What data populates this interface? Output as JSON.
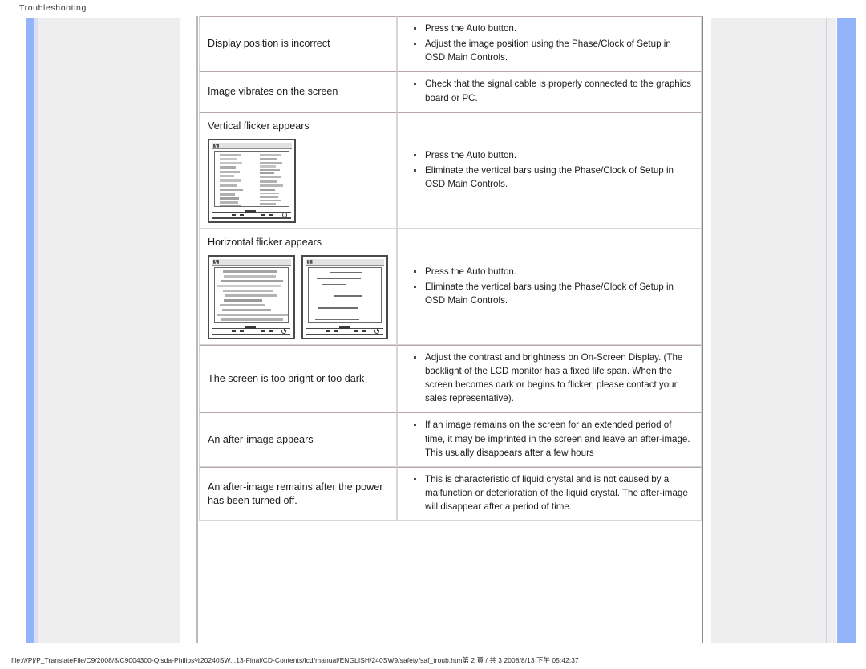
{
  "header": {
    "title": "Troubleshooting"
  },
  "footer": {
    "text": "file:///P|/P_TranslateFile/C9/2008/8/C9004300-Qisda-Philips%20240SW...13-Final/CD-Contents/lcd/manual/ENGLISH/240SW9/safety/saf_troub.htm第 2 頁 / 共 3 2008/8/13 下午 05:42:37"
  },
  "colors": {
    "accent_blue": "#93b3fa",
    "panel_gray": "#eeeeee",
    "table_border": "#d6d6d6",
    "row_top_border": "#b6a8a8",
    "text": "#1c1c1c"
  },
  "table": {
    "rows": [
      {
        "symptom": "Display position is incorrect",
        "has_image": false,
        "image_type": "",
        "solutions": [
          "Press the Auto button.",
          "Adjust the image position using the Phase/Clock of Setup in OSD Main Controls."
        ]
      },
      {
        "symptom": "Image vibrates on the screen",
        "has_image": false,
        "image_type": "",
        "solutions": [
          "Check that the signal cable is properly connected to the graphics board or PC."
        ]
      },
      {
        "symptom": "Vertical flicker appears",
        "has_image": true,
        "image_type": "vertical-flicker-monitor",
        "solutions": [
          "Press the Auto button.",
          "Eliminate the vertical bars using the Phase/Clock of Setup in OSD Main Controls."
        ]
      },
      {
        "symptom": "Horizontal flicker appears",
        "has_image": true,
        "image_type": "horizontal-flicker-monitors",
        "solutions": [
          "Press the Auto button.",
          "Eliminate the vertical bars using the Phase/Clock of Setup in OSD Main Controls."
        ]
      },
      {
        "symptom": "The screen is too bright or too dark",
        "has_image": false,
        "image_type": "",
        "solutions": [
          "Adjust the contrast and brightness on On-Screen Display. (The backlight of the LCD monitor has a fixed life span. When the screen becomes dark or begins to flicker, please contact your sales representative)."
        ]
      },
      {
        "symptom": "An after-image appears",
        "has_image": false,
        "image_type": "",
        "solutions": [
          "If an image remains on the screen for an extended period of time, it may be imprinted in the screen and leave an after-image. This usually disappears after a few hours"
        ]
      },
      {
        "symptom": "An after-image remains after the power has been turned off.",
        "has_image": false,
        "image_type": "",
        "solutions": [
          "This is characteristic of liquid crystal and is not caused by a malfunction or deterioration of the liquid crystal. The after-image will disappear after a period of time."
        ]
      }
    ]
  }
}
